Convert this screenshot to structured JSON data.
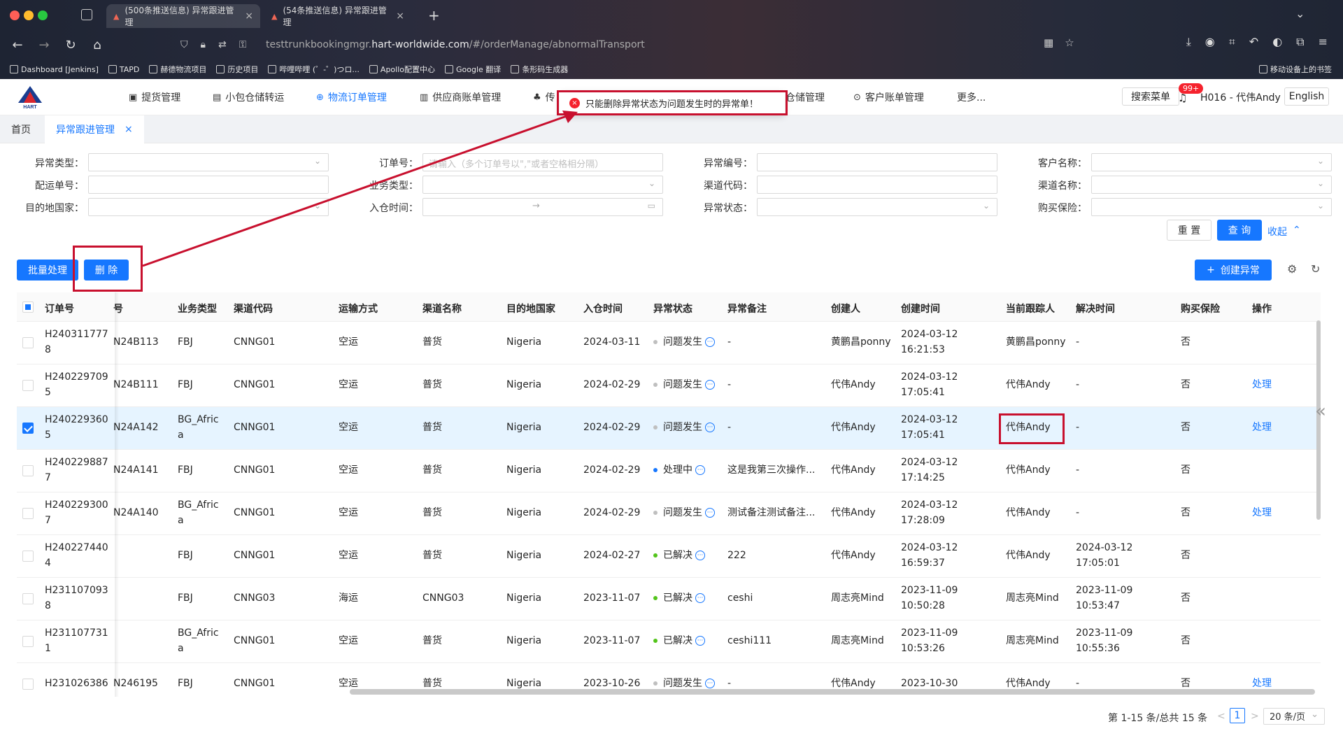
{
  "browser": {
    "tabs": [
      {
        "label": "(500条推送信息) 异常跟进管理"
      },
      {
        "label": "(54条推送信息) 异常跟进管理"
      }
    ],
    "new_tab": "+",
    "url_prefix": "testtrunkbookingmgr.",
    "url_domain": "hart-worldwide.com",
    "url_path": "/#/orderManage/abnormalTransport",
    "bookmarks": [
      "Dashboard [Jenkins]",
      "TAPD",
      "赫德物流项目",
      "历史项目",
      "哔哩哔哩 (゜-゜)つロ...",
      "Apollo配置中心",
      "Google 翻译",
      "条形码生成器"
    ],
    "mobile_bookmarks": "移动设备上的书签"
  },
  "app": {
    "logo_text": "HART",
    "menu": [
      "提货管理",
      "小包仓储转运",
      "物流订单管理",
      "供应商账单管理",
      "传",
      "仓储管理",
      "客户账单管理",
      "更多..."
    ],
    "active_menu": "物流订单管理",
    "search_menu": "搜索菜单",
    "notif_badge": "99+",
    "user": "H016 - 代伟Andy",
    "lang": "English"
  },
  "page_tabs": [
    {
      "label": "首页"
    },
    {
      "label": "异常跟进管理",
      "close": "×"
    }
  ],
  "filters": {
    "abnormal_type": "异常类型：",
    "order_no": "订单号：",
    "order_no_placeholder": "请输入（多个订单号以\",\"或者空格相分隔）",
    "abnormal_no": "异常编号：",
    "customer_name": "客户名称：",
    "delivery_no": "配运单号：",
    "business_type": "业务类型：",
    "channel_code": "渠道代码：",
    "channel_name": "渠道名称：",
    "dest_country": "目的地国家：",
    "warehouse_time": "入仓时间：",
    "date_arrow": "→",
    "abnormal_status": "异常状态：",
    "insurance": "购买保险：",
    "reset": "重 置",
    "query": "查 询",
    "collapse": "收起"
  },
  "actions": {
    "batch": "批量处理",
    "delete": "删 除",
    "create": "创建异常",
    "create_icon": "+"
  },
  "toast": {
    "text": "只能删除异常状态为问题发生时的异常单！",
    "icon": "×"
  },
  "table": {
    "headers": [
      "订单号",
      "号",
      "业务类型",
      "渠道代码",
      "运输方式",
      "渠道名称",
      "目的地国家",
      "入仓时间",
      "异常状态",
      "异常备注",
      "创建人",
      "创建时间",
      "当前跟踪人",
      "解决时间",
      "购买保险",
      "操作"
    ],
    "rows": [
      {
        "order1": "H240311777",
        "order2": "8",
        "dno": "N24B113",
        "biz1": "FBJ",
        "biz2": "",
        "code": "CNNG01",
        "mode": "空运",
        "cname": "普货",
        "country": "Nigeria",
        "in": "2024-03-11",
        "status": "问题发生",
        "st": "gray",
        "remark": "-",
        "creator": "黄鹏昌ponny",
        "ct1": "2024-03-12",
        "ct2": "16:21:53",
        "tracker": "黄鹏昌ponny",
        "rt1": "-",
        "rt2": "",
        "ins": "否",
        "op": "",
        "checked": false
      },
      {
        "order1": "H240229709",
        "order2": "5",
        "dno": "N24B111",
        "biz1": "FBJ",
        "biz2": "",
        "code": "CNNG01",
        "mode": "空运",
        "cname": "普货",
        "country": "Nigeria",
        "in": "2024-02-29",
        "status": "问题发生",
        "st": "gray",
        "remark": "-",
        "creator": "代伟Andy",
        "ct1": "2024-03-12",
        "ct2": "17:05:41",
        "tracker": "代伟Andy",
        "rt1": "-",
        "rt2": "",
        "ins": "否",
        "op": "处理",
        "checked": false
      },
      {
        "order1": "H240229360",
        "order2": "5",
        "dno": "N24A142",
        "biz1": "BG_Afric",
        "biz2": "a",
        "code": "CNNG01",
        "mode": "空运",
        "cname": "普货",
        "country": "Nigeria",
        "in": "2024-02-29",
        "status": "问题发生",
        "st": "gray",
        "remark": "-",
        "creator": "代伟Andy",
        "ct1": "2024-03-12",
        "ct2": "17:05:41",
        "tracker": "代伟Andy",
        "rt1": "-",
        "rt2": "",
        "ins": "否",
        "op": "处理",
        "checked": true
      },
      {
        "order1": "H240229887",
        "order2": "7",
        "dno": "N24A141",
        "biz1": "FBJ",
        "biz2": "",
        "code": "CNNG01",
        "mode": "空运",
        "cname": "普货",
        "country": "Nigeria",
        "in": "2024-02-29",
        "status": "处理中",
        "st": "blue",
        "remark": "这是我第三次操作...",
        "creator": "代伟Andy",
        "ct1": "2024-03-12",
        "ct2": "17:14:25",
        "tracker": "代伟Andy",
        "rt1": "-",
        "rt2": "",
        "ins": "否",
        "op": "",
        "checked": false
      },
      {
        "order1": "H240229300",
        "order2": "7",
        "dno": "N24A140",
        "biz1": "BG_Afric",
        "biz2": "a",
        "code": "CNNG01",
        "mode": "空运",
        "cname": "普货",
        "country": "Nigeria",
        "in": "2024-02-29",
        "status": "问题发生",
        "st": "gray",
        "remark": "测试备注测试备注...",
        "creator": "代伟Andy",
        "ct1": "2024-03-12",
        "ct2": "17:28:09",
        "tracker": "代伟Andy",
        "rt1": "-",
        "rt2": "",
        "ins": "否",
        "op": "处理",
        "checked": false
      },
      {
        "order1": "H240227440",
        "order2": "4",
        "dno": "",
        "biz1": "FBJ",
        "biz2": "",
        "code": "CNNG01",
        "mode": "空运",
        "cname": "普货",
        "country": "Nigeria",
        "in": "2024-02-27",
        "status": "已解决",
        "st": "green",
        "remark": "222",
        "creator": "代伟Andy",
        "ct1": "2024-03-12",
        "ct2": "16:59:37",
        "tracker": "代伟Andy",
        "rt1": "2024-03-12",
        "rt2": "17:05:01",
        "ins": "否",
        "op": "",
        "checked": false
      },
      {
        "order1": "H231107093",
        "order2": "8",
        "dno": "",
        "biz1": "FBJ",
        "biz2": "",
        "code": "CNNG03",
        "mode": "海运",
        "cname": "CNNG03",
        "country": "Nigeria",
        "in": "2023-11-07",
        "status": "已解决",
        "st": "green",
        "remark": "ceshi",
        "creator": "周志亮Mind",
        "ct1": "2023-11-09",
        "ct2": "10:50:28",
        "tracker": "周志亮Mind",
        "rt1": "2023-11-09",
        "rt2": "10:53:47",
        "ins": "否",
        "op": "",
        "checked": false
      },
      {
        "order1": "H231107731",
        "order2": "1",
        "dno": "",
        "biz1": "BG_Afric",
        "biz2": "a",
        "code": "CNNG01",
        "mode": "空运",
        "cname": "普货",
        "country": "Nigeria",
        "in": "2023-11-07",
        "status": "已解决",
        "st": "green",
        "remark": "ceshi111",
        "creator": "周志亮Mind",
        "ct1": "2023-11-09",
        "ct2": "10:53:26",
        "tracker": "周志亮Mind",
        "rt1": "2023-11-09",
        "rt2": "10:55:36",
        "ins": "否",
        "op": "",
        "checked": false
      },
      {
        "order1": "H231026386",
        "order2": "",
        "dno": "N246195",
        "biz1": "FBJ",
        "biz2": "",
        "code": "CNNG01",
        "mode": "空运",
        "cname": "普货",
        "country": "Nigeria",
        "in": "2023-10-26",
        "status": "问题发生",
        "st": "gray",
        "remark": "-",
        "creator": "代伟Andy",
        "ct1": "2023-10-30",
        "ct2": "",
        "tracker": "代伟Andy",
        "rt1": "-",
        "rt2": "",
        "ins": "否",
        "op": "处理",
        "checked": false
      }
    ]
  },
  "pagination": {
    "summary": "第 1-15 条/总共 15 条",
    "prev": "<",
    "current": "1",
    "next": ">",
    "page_size": "20 条/页"
  },
  "colors": {
    "primary": "#1677ff",
    "annotation": "#c8102e",
    "green": "#52c41a",
    "blue": "#1677ff",
    "gray": "#bfbfbf"
  }
}
